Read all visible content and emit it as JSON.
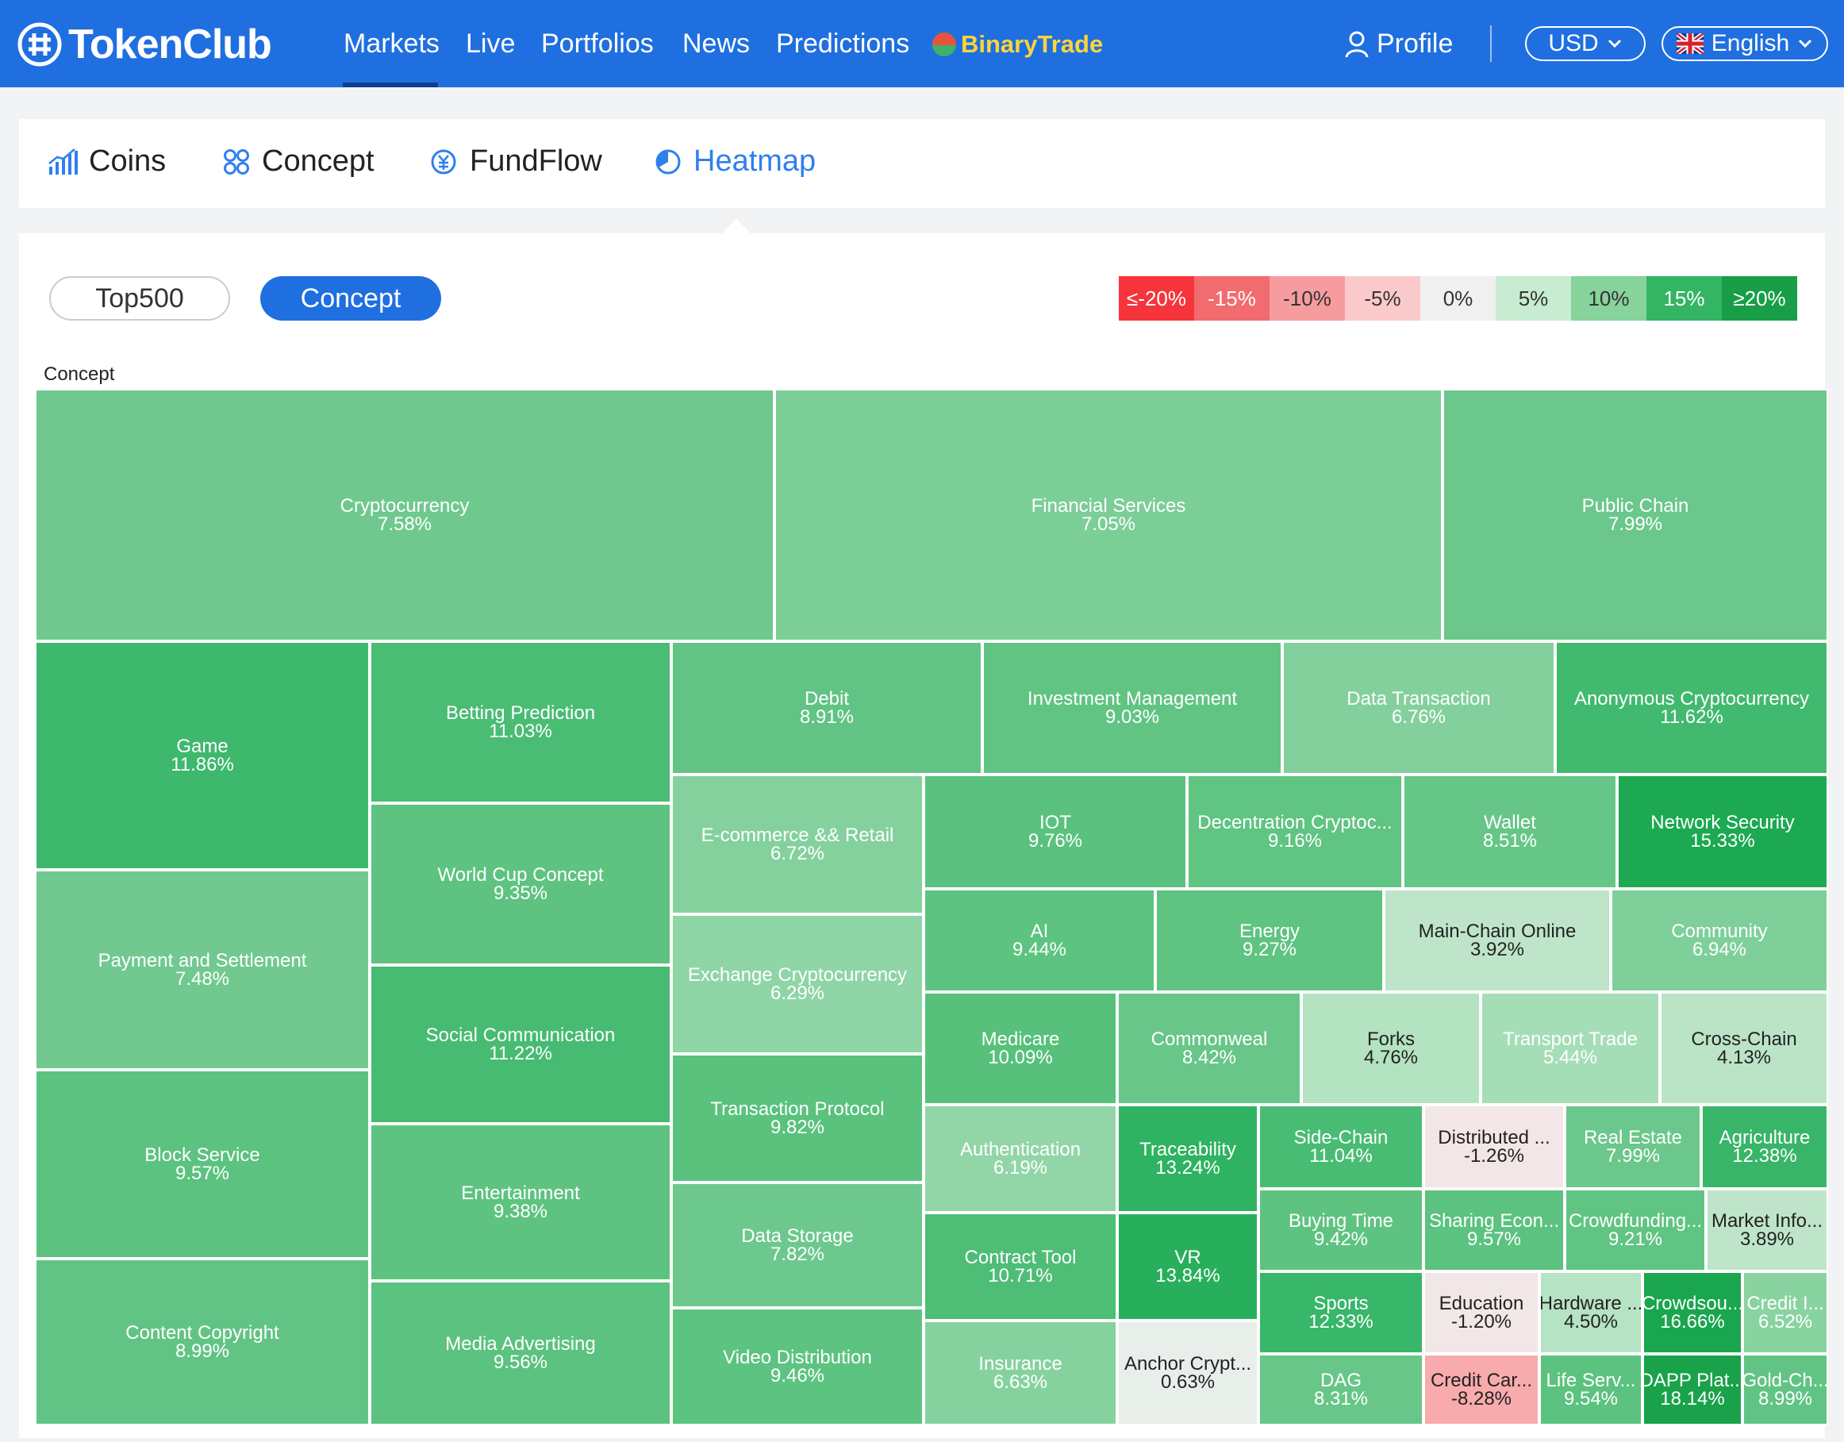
{
  "brand": {
    "name": "TokenClub"
  },
  "nav": {
    "items": [
      "Markets",
      "Live",
      "Portfolios",
      "News",
      "Predictions"
    ],
    "binary_trade": "BinaryTrade",
    "profile": "Profile",
    "currency": "USD",
    "language": "English"
  },
  "subtabs": [
    "Coins",
    "Concept",
    "FundFlow",
    "Heatmap"
  ],
  "active_subtab": "Heatmap",
  "toggle": {
    "top500": "Top500",
    "concept": "Concept"
  },
  "legend": [
    {
      "label": "≤-20%",
      "color": "#f5343c"
    },
    {
      "label": "-15%",
      "color": "#f26b6f"
    },
    {
      "label": "-10%",
      "color": "#f79c9e"
    },
    {
      "label": "-5%",
      "color": "#fac9ca"
    },
    {
      "label": "0%",
      "color": "#f0f0f0"
    },
    {
      "label": "5%",
      "color": "#c7ecd1"
    },
    {
      "label": "10%",
      "color": "#86d39c"
    },
    {
      "label": "15%",
      "color": "#33b563"
    },
    {
      "label": "≥20%",
      "color": "#179e46"
    }
  ],
  "treemap_title": "Concept",
  "tiles": [
    {
      "name": "Cryptocurrency",
      "change": "7.58%"
    },
    {
      "name": "Financial Services",
      "change": "7.05%"
    },
    {
      "name": "Public Chain",
      "change": "7.99%"
    },
    {
      "name": "Game",
      "change": "11.86%"
    },
    {
      "name": "Betting Prediction",
      "change": "11.03%"
    },
    {
      "name": "Debit",
      "change": "8.91%"
    },
    {
      "name": "Investment Management",
      "change": "9.03%"
    },
    {
      "name": "Data Transaction",
      "change": "6.76%"
    },
    {
      "name": "Anonymous Cryptocurrency",
      "change": "11.62%"
    },
    {
      "name": "E-commerce && Retail",
      "change": "6.72%"
    },
    {
      "name": "IOT",
      "change": "9.76%"
    },
    {
      "name": "Decentration Cryptoc...",
      "change": "9.16%"
    },
    {
      "name": "Wallet",
      "change": "8.51%"
    },
    {
      "name": "Network Security",
      "change": "15.33%"
    },
    {
      "name": "World Cup Concept",
      "change": "9.35%"
    },
    {
      "name": "Payment and Settlement",
      "change": "7.48%"
    },
    {
      "name": "Exchange Cryptocurrency",
      "change": "6.29%"
    },
    {
      "name": "AI",
      "change": "9.44%"
    },
    {
      "name": "Energy",
      "change": "9.27%"
    },
    {
      "name": "Main-Chain Online",
      "change": "3.92%"
    },
    {
      "name": "Community",
      "change": "6.94%"
    },
    {
      "name": "Social Communication",
      "change": "11.22%"
    },
    {
      "name": "Medicare",
      "change": "10.09%"
    },
    {
      "name": "Commonweal",
      "change": "8.42%"
    },
    {
      "name": "Forks",
      "change": "4.76%"
    },
    {
      "name": "Transport Trade",
      "change": "5.44%"
    },
    {
      "name": "Cross-Chain",
      "change": "4.13%"
    },
    {
      "name": "Transaction Protocol",
      "change": "9.82%"
    },
    {
      "name": "Block Service",
      "change": "9.57%"
    },
    {
      "name": "Authentication",
      "change": "6.19%"
    },
    {
      "name": "Traceability",
      "change": "13.24%"
    },
    {
      "name": "Side-Chain",
      "change": "11.04%"
    },
    {
      "name": "Distributed ...",
      "change": "-1.26%"
    },
    {
      "name": "Real Estate",
      "change": "7.99%"
    },
    {
      "name": "Agriculture",
      "change": "12.38%"
    },
    {
      "name": "Entertainment",
      "change": "9.38%"
    },
    {
      "name": "Buying Time",
      "change": "9.42%"
    },
    {
      "name": "Sharing Econ...",
      "change": "9.57%"
    },
    {
      "name": "Crowdfunding...",
      "change": "9.21%"
    },
    {
      "name": "Market Info...",
      "change": "3.89%"
    },
    {
      "name": "Data Storage",
      "change": "7.82%"
    },
    {
      "name": "Contract Tool",
      "change": "10.71%"
    },
    {
      "name": "VR",
      "change": "13.84%"
    },
    {
      "name": "Content Copyright",
      "change": "8.99%"
    },
    {
      "name": "Sports",
      "change": "12.33%"
    },
    {
      "name": "Education",
      "change": "-1.20%"
    },
    {
      "name": "Hardware ...",
      "change": "4.50%"
    },
    {
      "name": "Crowdsou...",
      "change": "16.66%"
    },
    {
      "name": "Credit I...",
      "change": "6.52%"
    },
    {
      "name": "Media Advertising",
      "change": "9.56%"
    },
    {
      "name": "Video Distribution",
      "change": "9.46%"
    },
    {
      "name": "Insurance",
      "change": "6.63%"
    },
    {
      "name": "Anchor Crypt...",
      "change": "0.63%"
    },
    {
      "name": "DAG",
      "change": "8.31%"
    },
    {
      "name": "Credit Car...",
      "change": "-8.28%"
    },
    {
      "name": "Life Serv...",
      "change": "9.54%"
    },
    {
      "name": "DAPP Plat...",
      "change": "18.14%"
    },
    {
      "name": "Gold-Ch...",
      "change": "8.99%"
    }
  ]
}
